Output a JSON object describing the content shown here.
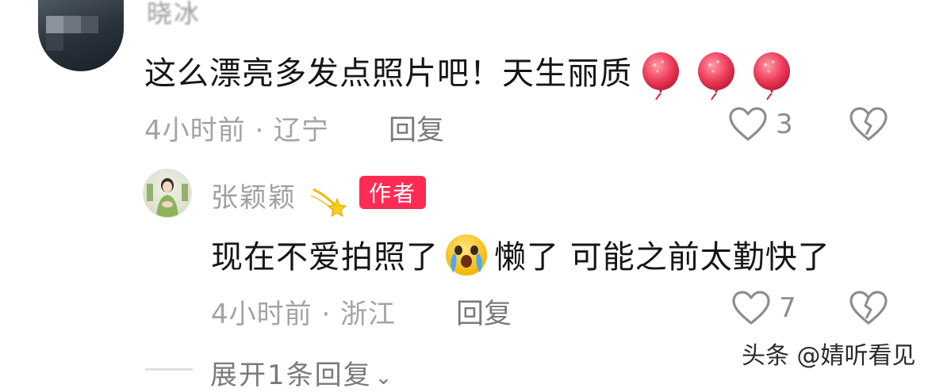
{
  "colors": {
    "badge_bg": "#fe2c55",
    "meta_text": "#a3a3a3",
    "comment_text": "#161616"
  },
  "comment1": {
    "author": "晓冰",
    "text": "这么漂亮多发点照片吧！天生丽质",
    "emoji": [
      "balloon-emoji",
      "balloon-emoji",
      "balloon-emoji"
    ],
    "meta": "4小时前 · 辽宁",
    "reply_label": "回复",
    "like_count": "3"
  },
  "comment2": {
    "author": "张颖颖",
    "author_badge": "作者",
    "text_part1": "现在不爱拍照了",
    "text_part2": "懒了 可能之前太勤快了",
    "emoji": "crying-face-emoji",
    "meta": "4小时前 · 浙江",
    "reply_label": "回复",
    "like_count": "7"
  },
  "expand_replies": "展开1条回复",
  "watermark": "头条 @婧听看见"
}
